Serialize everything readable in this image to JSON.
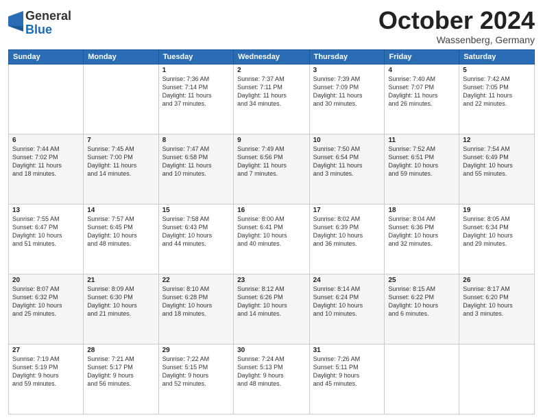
{
  "header": {
    "logo": {
      "general": "General",
      "blue": "Blue"
    },
    "month": "October 2024",
    "location": "Wassenberg, Germany"
  },
  "weekdays": [
    "Sunday",
    "Monday",
    "Tuesday",
    "Wednesday",
    "Thursday",
    "Friday",
    "Saturday"
  ],
  "weeks": [
    [
      {
        "day": "",
        "info": ""
      },
      {
        "day": "",
        "info": ""
      },
      {
        "day": "1",
        "info": "Sunrise: 7:36 AM\nSunset: 7:14 PM\nDaylight: 11 hours\nand 37 minutes."
      },
      {
        "day": "2",
        "info": "Sunrise: 7:37 AM\nSunset: 7:11 PM\nDaylight: 11 hours\nand 34 minutes."
      },
      {
        "day": "3",
        "info": "Sunrise: 7:39 AM\nSunset: 7:09 PM\nDaylight: 11 hours\nand 30 minutes."
      },
      {
        "day": "4",
        "info": "Sunrise: 7:40 AM\nSunset: 7:07 PM\nDaylight: 11 hours\nand 26 minutes."
      },
      {
        "day": "5",
        "info": "Sunrise: 7:42 AM\nSunset: 7:05 PM\nDaylight: 11 hours\nand 22 minutes."
      }
    ],
    [
      {
        "day": "6",
        "info": "Sunrise: 7:44 AM\nSunset: 7:02 PM\nDaylight: 11 hours\nand 18 minutes."
      },
      {
        "day": "7",
        "info": "Sunrise: 7:45 AM\nSunset: 7:00 PM\nDaylight: 11 hours\nand 14 minutes."
      },
      {
        "day": "8",
        "info": "Sunrise: 7:47 AM\nSunset: 6:58 PM\nDaylight: 11 hours\nand 10 minutes."
      },
      {
        "day": "9",
        "info": "Sunrise: 7:49 AM\nSunset: 6:56 PM\nDaylight: 11 hours\nand 7 minutes."
      },
      {
        "day": "10",
        "info": "Sunrise: 7:50 AM\nSunset: 6:54 PM\nDaylight: 11 hours\nand 3 minutes."
      },
      {
        "day": "11",
        "info": "Sunrise: 7:52 AM\nSunset: 6:51 PM\nDaylight: 10 hours\nand 59 minutes."
      },
      {
        "day": "12",
        "info": "Sunrise: 7:54 AM\nSunset: 6:49 PM\nDaylight: 10 hours\nand 55 minutes."
      }
    ],
    [
      {
        "day": "13",
        "info": "Sunrise: 7:55 AM\nSunset: 6:47 PM\nDaylight: 10 hours\nand 51 minutes."
      },
      {
        "day": "14",
        "info": "Sunrise: 7:57 AM\nSunset: 6:45 PM\nDaylight: 10 hours\nand 48 minutes."
      },
      {
        "day": "15",
        "info": "Sunrise: 7:58 AM\nSunset: 6:43 PM\nDaylight: 10 hours\nand 44 minutes."
      },
      {
        "day": "16",
        "info": "Sunrise: 8:00 AM\nSunset: 6:41 PM\nDaylight: 10 hours\nand 40 minutes."
      },
      {
        "day": "17",
        "info": "Sunrise: 8:02 AM\nSunset: 6:39 PM\nDaylight: 10 hours\nand 36 minutes."
      },
      {
        "day": "18",
        "info": "Sunrise: 8:04 AM\nSunset: 6:36 PM\nDaylight: 10 hours\nand 32 minutes."
      },
      {
        "day": "19",
        "info": "Sunrise: 8:05 AM\nSunset: 6:34 PM\nDaylight: 10 hours\nand 29 minutes."
      }
    ],
    [
      {
        "day": "20",
        "info": "Sunrise: 8:07 AM\nSunset: 6:32 PM\nDaylight: 10 hours\nand 25 minutes."
      },
      {
        "day": "21",
        "info": "Sunrise: 8:09 AM\nSunset: 6:30 PM\nDaylight: 10 hours\nand 21 minutes."
      },
      {
        "day": "22",
        "info": "Sunrise: 8:10 AM\nSunset: 6:28 PM\nDaylight: 10 hours\nand 18 minutes."
      },
      {
        "day": "23",
        "info": "Sunrise: 8:12 AM\nSunset: 6:26 PM\nDaylight: 10 hours\nand 14 minutes."
      },
      {
        "day": "24",
        "info": "Sunrise: 8:14 AM\nSunset: 6:24 PM\nDaylight: 10 hours\nand 10 minutes."
      },
      {
        "day": "25",
        "info": "Sunrise: 8:15 AM\nSunset: 6:22 PM\nDaylight: 10 hours\nand 6 minutes."
      },
      {
        "day": "26",
        "info": "Sunrise: 8:17 AM\nSunset: 6:20 PM\nDaylight: 10 hours\nand 3 minutes."
      }
    ],
    [
      {
        "day": "27",
        "info": "Sunrise: 7:19 AM\nSunset: 5:19 PM\nDaylight: 9 hours\nand 59 minutes."
      },
      {
        "day": "28",
        "info": "Sunrise: 7:21 AM\nSunset: 5:17 PM\nDaylight: 9 hours\nand 56 minutes."
      },
      {
        "day": "29",
        "info": "Sunrise: 7:22 AM\nSunset: 5:15 PM\nDaylight: 9 hours\nand 52 minutes."
      },
      {
        "day": "30",
        "info": "Sunrise: 7:24 AM\nSunset: 5:13 PM\nDaylight: 9 hours\nand 48 minutes."
      },
      {
        "day": "31",
        "info": "Sunrise: 7:26 AM\nSunset: 5:11 PM\nDaylight: 9 hours\nand 45 minutes."
      },
      {
        "day": "",
        "info": ""
      },
      {
        "day": "",
        "info": ""
      }
    ]
  ]
}
